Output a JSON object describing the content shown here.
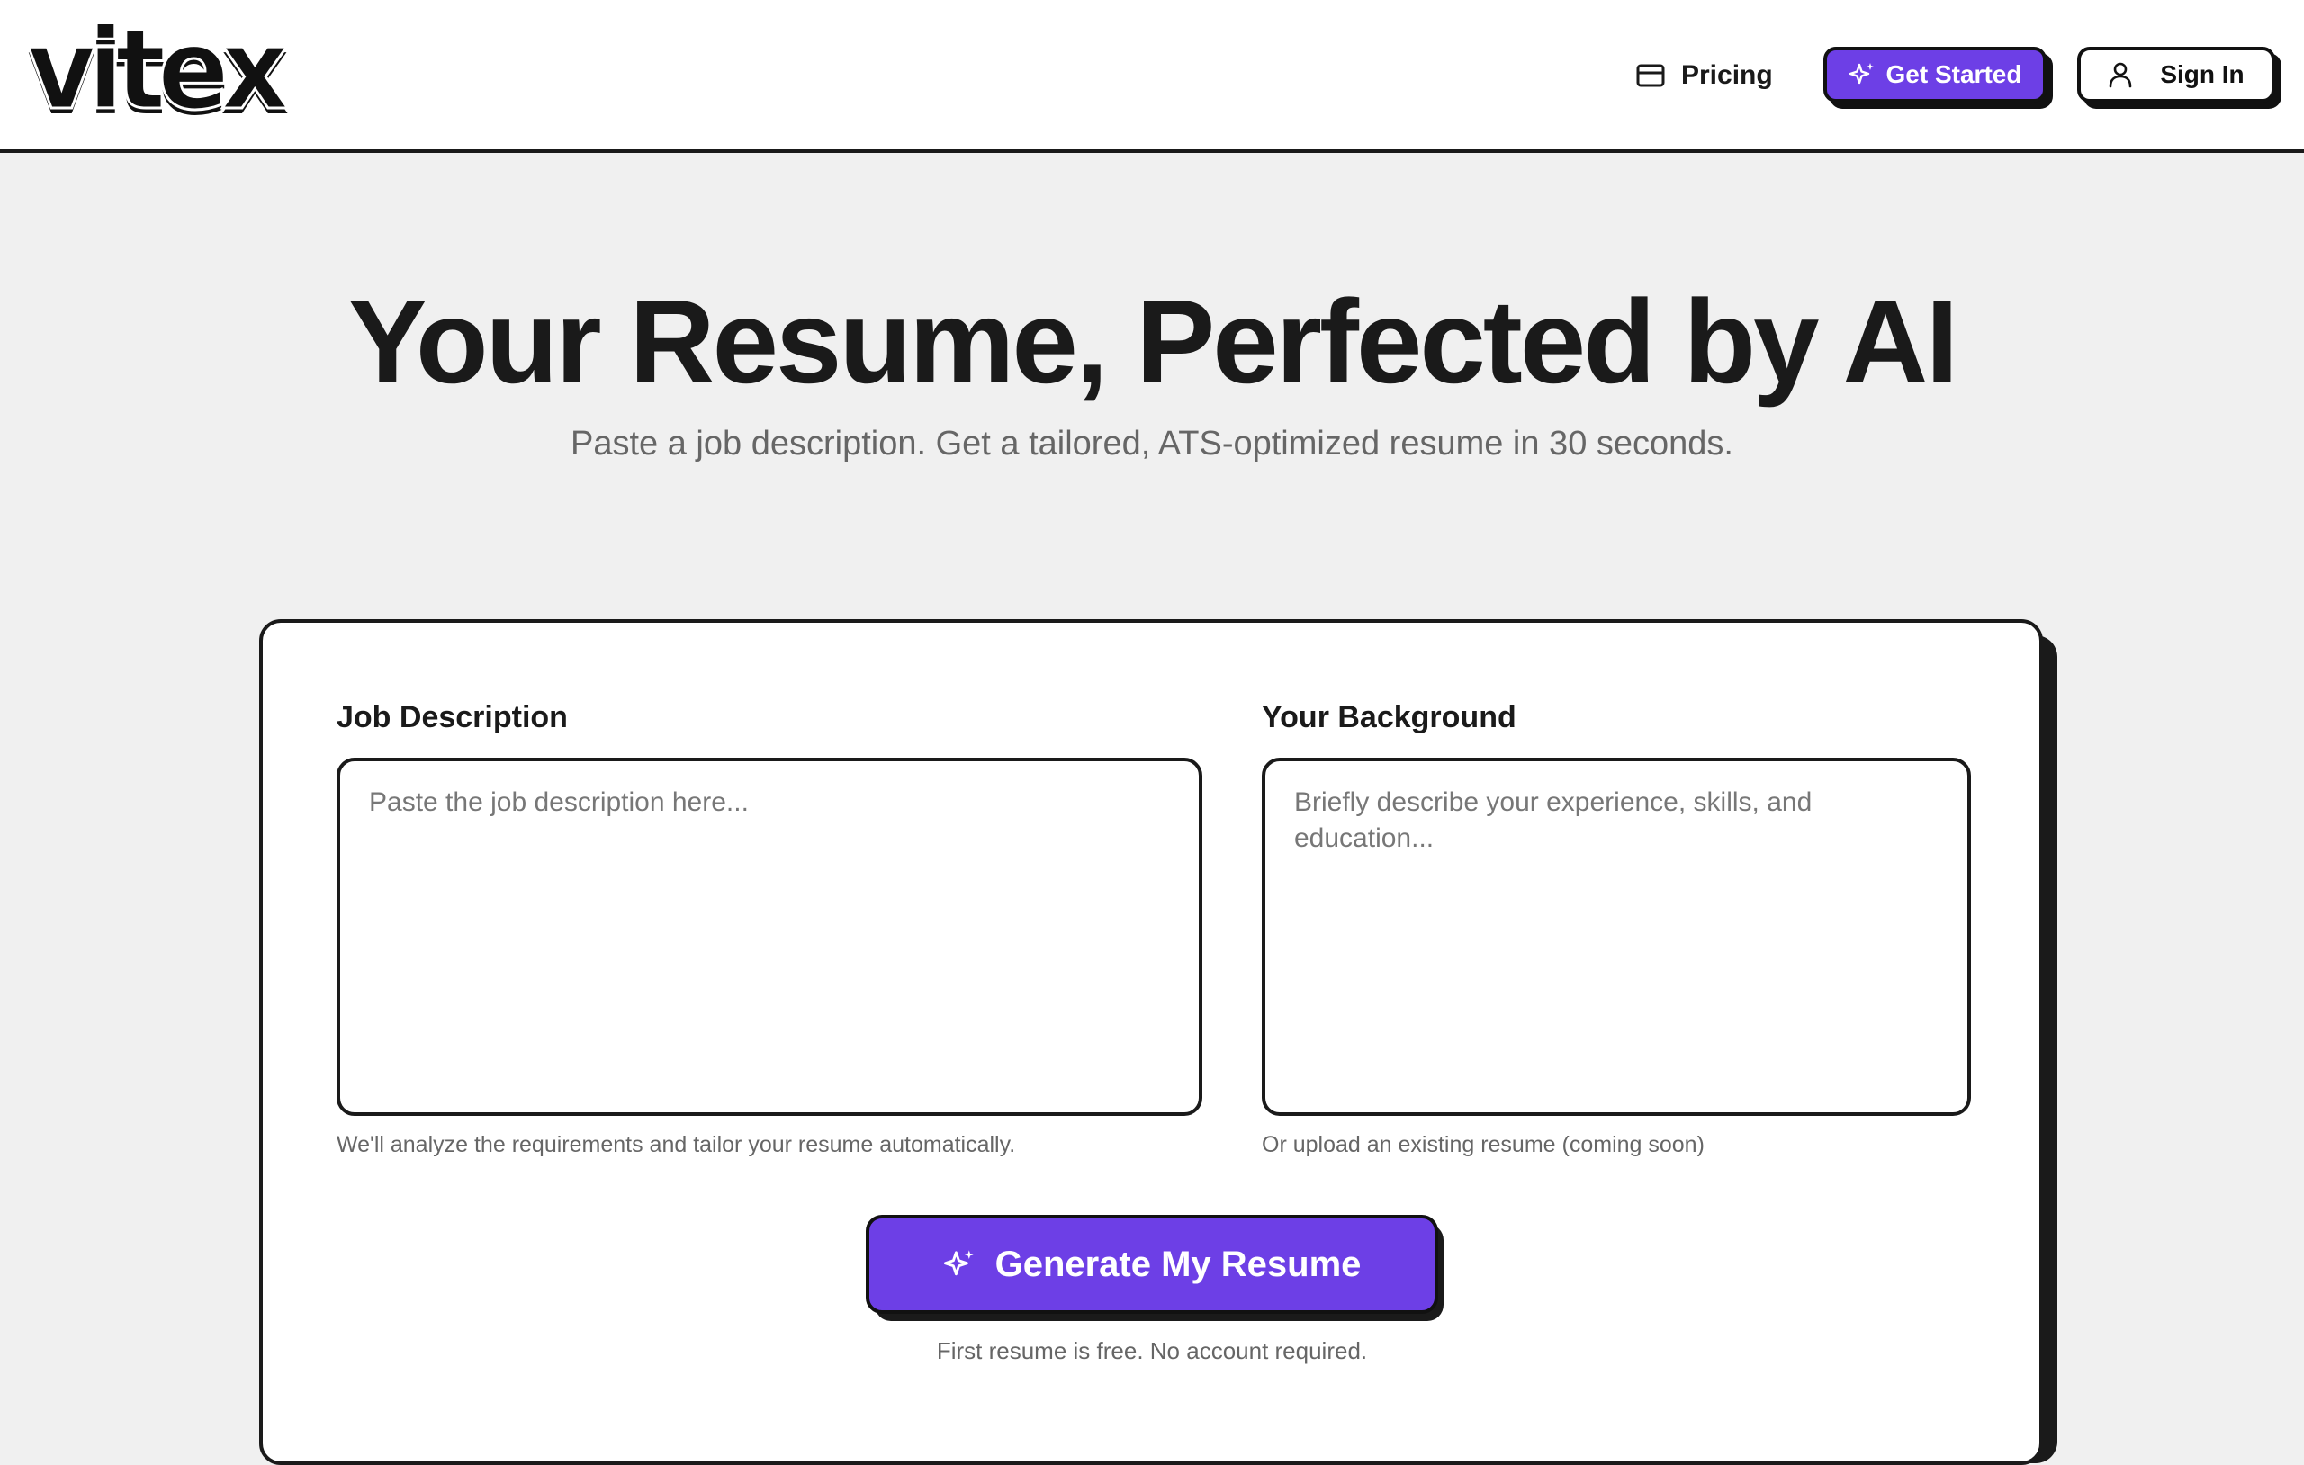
{
  "header": {
    "logo_text": "vitex",
    "nav": {
      "pricing_label": "Pricing",
      "get_started_label": "Get Started",
      "sign_in_label": "Sign In"
    }
  },
  "hero": {
    "title": "Your Resume, Perfected by AI",
    "subtitle": "Paste a job description. Get a tailored, ATS-optimized resume in 30 seconds."
  },
  "form": {
    "job_description": {
      "label": "Job Description",
      "placeholder": "Paste the job description here...",
      "value": "",
      "hint": "We'll analyze the requirements and tailor your resume automatically."
    },
    "background": {
      "label": "Your Background",
      "placeholder": "Briefly describe your experience, skills, and education...",
      "value": "",
      "hint": "Or upload an existing resume (coming soon)"
    },
    "generate_label": "Generate My Resume",
    "free_note": "First resume is free. No account required."
  },
  "colors": {
    "accent": "#6d3fe6",
    "ink": "#1a1a1a",
    "page_bg": "#f0f0f0",
    "muted": "#666666"
  },
  "icons": {
    "pricing": "card-icon",
    "get_started": "sparkles-icon",
    "sign_in": "user-icon",
    "generate": "sparkles-icon"
  }
}
